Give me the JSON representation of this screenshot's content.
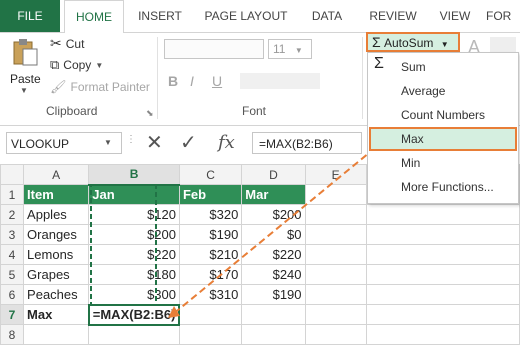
{
  "tabs": [
    "FILE",
    "HOME",
    "INSERT",
    "PAGE LAYOUT",
    "DATA",
    "REVIEW",
    "VIEW",
    "FOR"
  ],
  "clipboard": {
    "paste": "Paste",
    "cut": "Cut",
    "copy": "Copy",
    "format_painter": "Format Painter",
    "group_label": "Clipboard"
  },
  "font": {
    "size": "11",
    "bold": "B",
    "italic": "I",
    "underline": "U",
    "group_label": "Font"
  },
  "autosum": {
    "button": "AutoSum",
    "menu": [
      "Sum",
      "Average",
      "Count Numbers",
      "Max",
      "Min",
      "More Functions..."
    ]
  },
  "formula_bar": {
    "name_box": "VLOOKUP",
    "fx": "fx",
    "content": "=MAX(B2:B6)"
  },
  "sheet": {
    "columns": [
      "A",
      "B",
      "C",
      "D",
      "E"
    ],
    "rows": [
      "1",
      "2",
      "3",
      "4",
      "5",
      "6",
      "7",
      "8"
    ],
    "header": [
      "Item",
      "Jan",
      "Feb",
      "Mar"
    ],
    "data": [
      [
        "Apples",
        "$120",
        "$320",
        "$200"
      ],
      [
        "Oranges",
        "$200",
        "$190",
        "$0"
      ],
      [
        "Lemons",
        "$220",
        "$210",
        "$220"
      ],
      [
        "Grapes",
        "$180",
        "$170",
        "$240"
      ],
      [
        "Peaches",
        "$300",
        "$310",
        "$190"
      ]
    ],
    "max_label": "Max",
    "formula_cell": "=MAX(B2:B6)"
  },
  "colors": {
    "excel_green": "#217346",
    "header_green": "#2f8f57",
    "highlight_orange": "#e87e37",
    "selection_fill": "#d5efe0"
  }
}
